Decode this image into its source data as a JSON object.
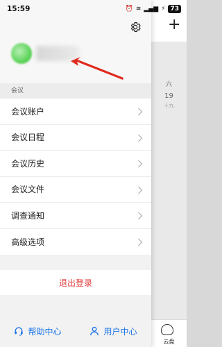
{
  "status_bar": {
    "time": "15:59",
    "battery": "73"
  },
  "background": {
    "plus_label": "+",
    "weekday": "六",
    "date": "19",
    "lunar": "十九",
    "cloud_label": "云盘"
  },
  "drawer": {
    "section_title": "会议",
    "menu": [
      {
        "label": "会议账户"
      },
      {
        "label": "会议日程"
      },
      {
        "label": "会议历史"
      },
      {
        "label": "会议文件"
      },
      {
        "label": "调查通知"
      },
      {
        "label": "高级选项"
      }
    ],
    "logout_label": "退出登录",
    "bottom": {
      "help_label": "帮助中心",
      "user_label": "用户中心"
    }
  },
  "colors": {
    "accent": "#1a73e8",
    "logout": "#e13b3b",
    "arrow": "#e02a1f",
    "avatar": "#5ed45a"
  },
  "icons": {
    "settings": "gear-icon",
    "help": "headset-icon",
    "user": "person-icon",
    "cloud": "cloud-disk-icon"
  }
}
